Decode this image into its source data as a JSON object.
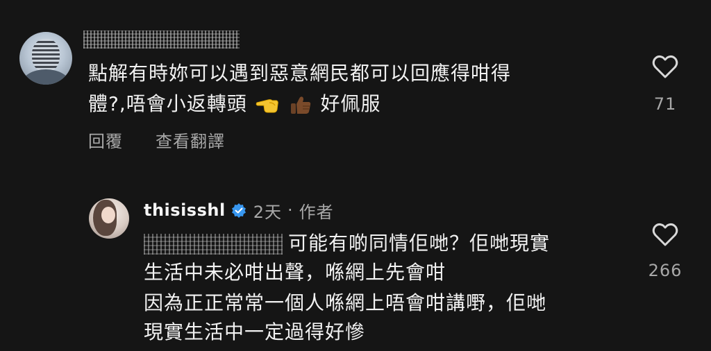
{
  "comment": {
    "username_redacted": true,
    "text_line1": "點解有時妳可以遇到惡意網民都可以回應得咁得",
    "text_line2_before": "體?,唔會小返轉頭",
    "text_line2_emojis": [
      "backhand-index-pointing-left-emoji",
      "thumbs-up-emoji"
    ],
    "text_line2_after": "好佩服",
    "reply_label": "回覆",
    "translate_label": "查看翻譯",
    "like_count": "71"
  },
  "reply": {
    "username": "thisisshl",
    "verified": true,
    "time": "2天",
    "separator": "·",
    "author_badge": "作者",
    "mention_redacted": true,
    "paragraph1_line1": "可能有啲同情佢哋？佢哋現實",
    "paragraph1_line2": "生活中未必咁出聲，喺網上先會咁",
    "paragraph2_line1": "因為正正常常一個人喺網上唔會咁講嘢，佢哋",
    "paragraph2_line2": "現實生活中一定過得好慘",
    "like_count": "266"
  },
  "colors": {
    "background": "#151515",
    "primary_text": "#f2f2f2",
    "secondary_text": "#a8a8a8",
    "verified_blue": "#3897f0"
  },
  "icons": [
    "heart-outline-icon",
    "verified-badge-icon"
  ]
}
